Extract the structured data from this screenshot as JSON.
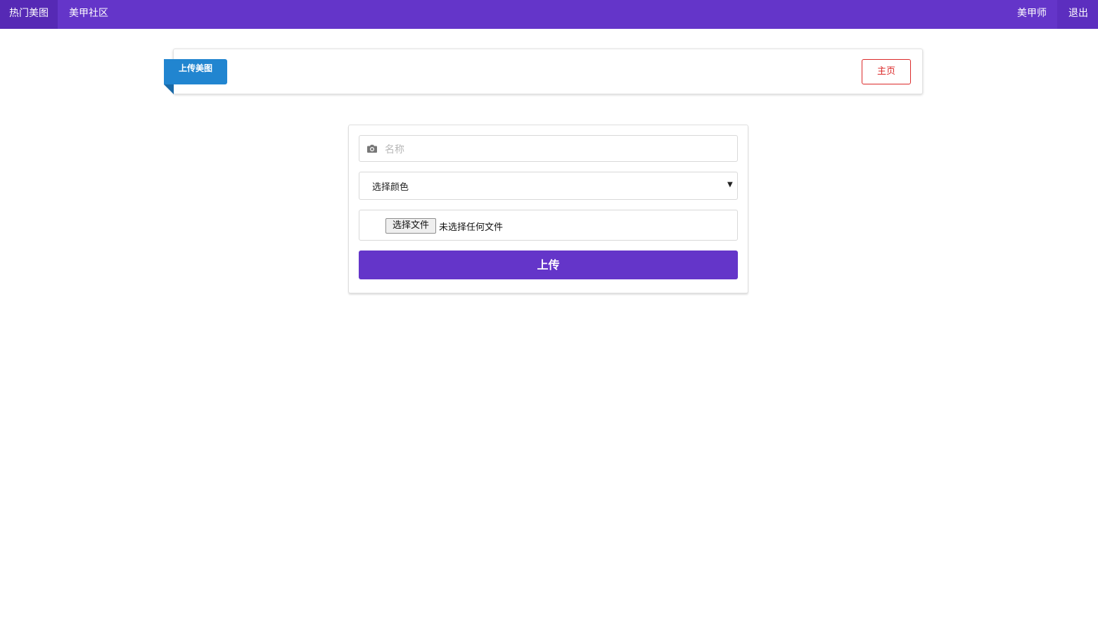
{
  "nav": {
    "left": [
      {
        "label": "热门美图",
        "active": true
      },
      {
        "label": "美甲社区",
        "active": false
      }
    ],
    "right": [
      {
        "label": "美甲师"
      },
      {
        "label": "退出"
      }
    ]
  },
  "header": {
    "ribbon_label": "上传美图",
    "home_label": "主页"
  },
  "form": {
    "name_placeholder": "名称",
    "color_select_value": "选择颜色",
    "file_button_label": "选择文件",
    "file_status": "未选择任何文件",
    "submit_label": "上传"
  },
  "icons": {
    "name_field": "camera-icon",
    "select": "chevron-down-icon"
  },
  "colors": {
    "primary": "#6435c9",
    "ribbon": "#2185d0",
    "home_button": "#db2828"
  }
}
